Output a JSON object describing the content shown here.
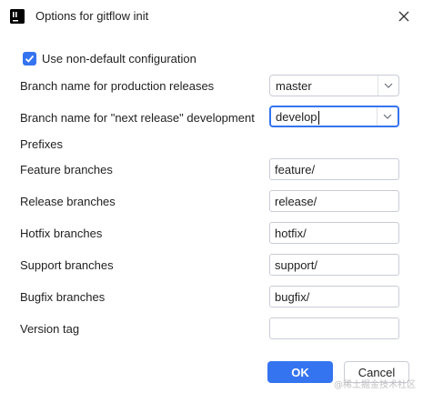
{
  "window": {
    "title": "Options for gitflow init",
    "app_icon": "intellij-icon",
    "close_icon": "close-icon"
  },
  "checkbox": {
    "label": "Use non-default configuration",
    "checked": true
  },
  "branches": {
    "production_label": "Branch name for production releases",
    "production_value": "master",
    "next_release_label": "Branch name for \"next release\" development",
    "next_release_value": "develop"
  },
  "prefixes": {
    "heading": "Prefixes",
    "feature_label": "Feature branches",
    "feature_value": "feature/",
    "release_label": "Release branches",
    "release_value": "release/",
    "hotfix_label": "Hotfix branches",
    "hotfix_value": "hotfix/",
    "support_label": "Support branches",
    "support_value": "support/",
    "bugfix_label": "Bugfix branches",
    "bugfix_value": "bugfix/",
    "version_tag_label": "Version tag",
    "version_tag_value": ""
  },
  "buttons": {
    "ok": "OK",
    "cancel": "Cancel"
  },
  "watermark": "@稀土掘金技术社区",
  "colors": {
    "accent": "#3574f0",
    "border": "#c9ccd6"
  }
}
